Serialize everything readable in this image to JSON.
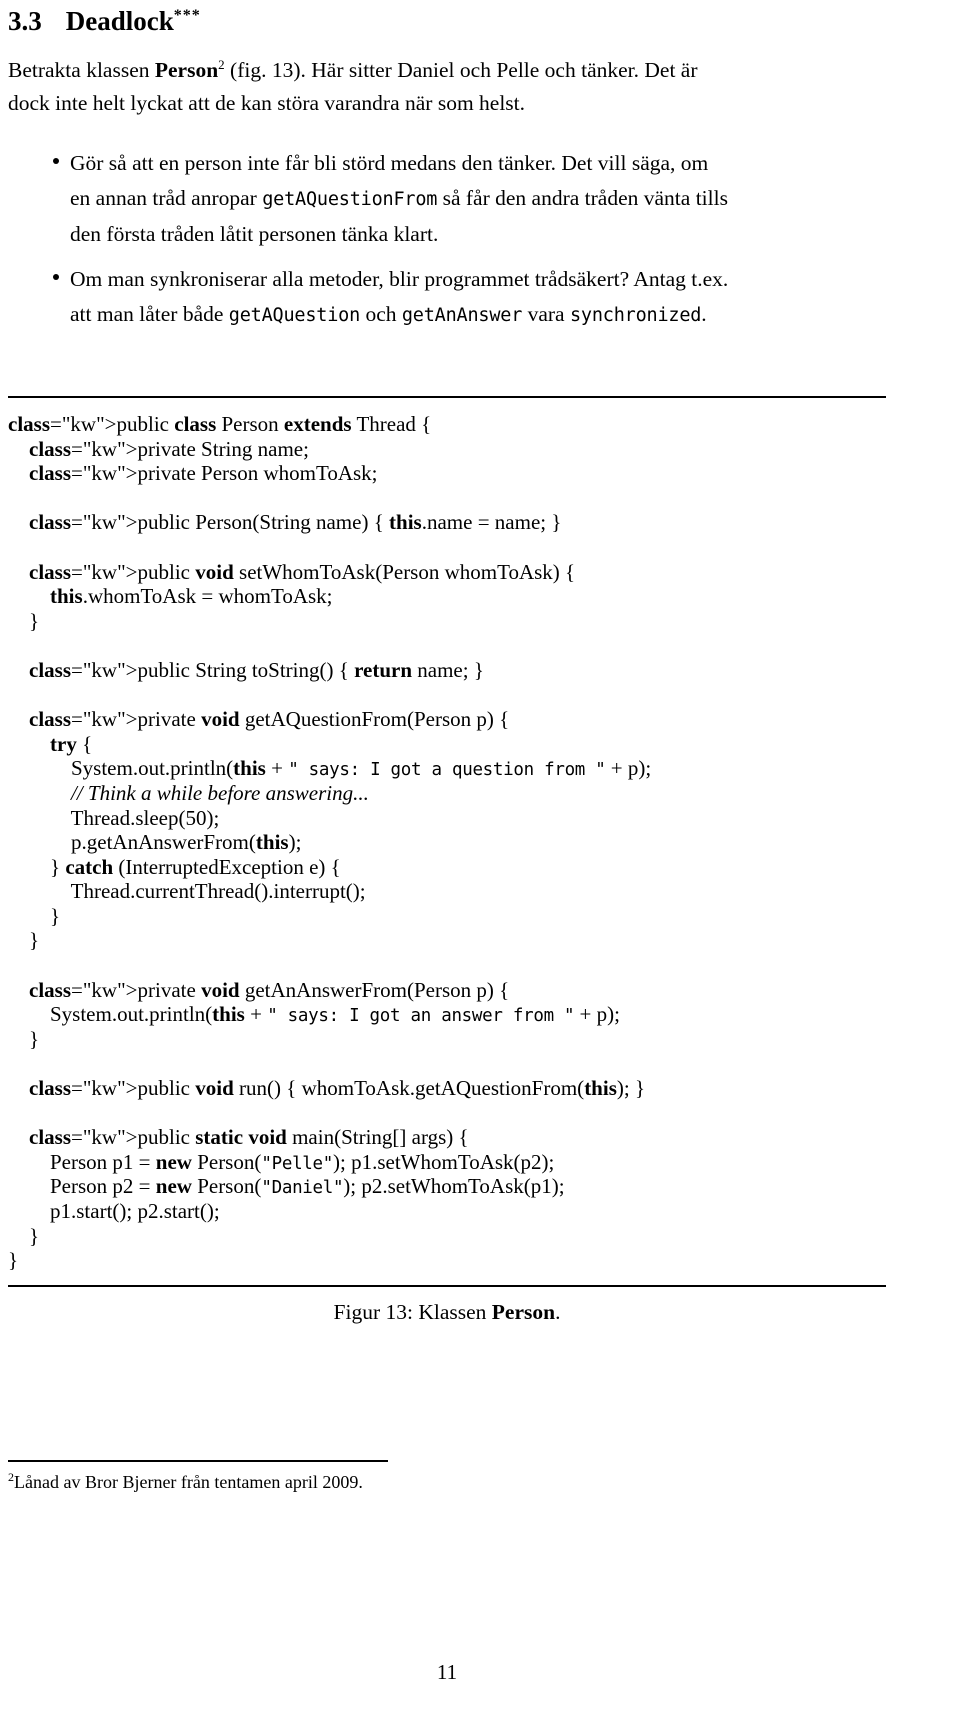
{
  "section": {
    "number": "3.3",
    "title": "Deadlock",
    "stars": "***"
  },
  "intro": {
    "line1_before": "Betrakta klassen ",
    "line1_bold": "Person",
    "line1_footnote_marker": "2",
    "line1_after": " (fig. 13). Här sitter Daniel och Pelle och tänker. Det är",
    "line2": "dock inte helt lyckat att de kan störa varandra när som helst."
  },
  "bullets": [
    {
      "lines": [
        {
          "text": "Gör så att en person inte får bli störd medans den tänker. Det vill säga, om"
        },
        {
          "prefix": "en annan tråd anropar ",
          "code": "getAQuestionFrom",
          "suffix": " så får den andra tråden vänta tills"
        },
        {
          "text": "den första tråden låtit personen tänka klart."
        }
      ]
    },
    {
      "lines": [
        {
          "text": "Om man synkroniserar alla metoder, blir programmet trådsäkert? Antag t.ex."
        },
        {
          "prefix": "att man låter både ",
          "code": "getAQuestion",
          "mid": " och ",
          "code2": "getAnAnswer",
          "suffix": " vara ",
          "code3": "synchronized",
          "tail": "."
        }
      ]
    }
  ],
  "code": {
    "lines": [
      "public class Person extends Thread {",
      "    private String name;",
      "    private Person whomToAsk;",
      "",
      "    public Person(String name) { this.name = name; }",
      "",
      "    public void setWhomToAsk(Person whomToAsk) {",
      "        this.whomToAsk = whomToAsk;",
      "    }",
      "",
      "    public String toString() { return name; }",
      "",
      "    private void getAQuestionFrom(Person p) {",
      "        try {",
      "            System.out.println(this + \" says: I got a question from \" + p);",
      "            // Think a while before answering...",
      "            Thread.sleep(50);",
      "            p.getAnAnswerFrom(this);",
      "        } catch (InterruptedException e) {",
      "            Thread.currentThread().interrupt();",
      "        }",
      "    }",
      "",
      "    private void getAnAnswerFrom(Person p) {",
      "        System.out.println(this + \" says: I got an answer from \" + p);",
      "    }",
      "",
      "    public void run() { whomToAsk.getAQuestionFrom(this); }",
      "",
      "    public static void main(String[] args) {",
      "        Person p1 = new Person(\"Pelle\"); p1.setWhomToAsk(p2);",
      "        Person p2 = new Person(\"Daniel\"); p2.setWhomToAsk(p1);",
      "        p1.start(); p2.start();",
      "    }",
      "}"
    ],
    "strings": {
      "says_question": "\" says: I got a question from \"",
      "says_answer": "\" says: I got an answer from \"",
      "pelle": "\"Pelle\"",
      "daniel": "\"Daniel\"",
      "comment": "// Think a while before answering...",
      "sleep_value": "50"
    }
  },
  "caption": {
    "prefix": "Figur 13: Klassen ",
    "bold": "Person",
    "suffix": "."
  },
  "footnote": {
    "marker": "2",
    "text": "Lånad av Bror Bjerner från tentamen april 2009."
  },
  "page_number": "11"
}
